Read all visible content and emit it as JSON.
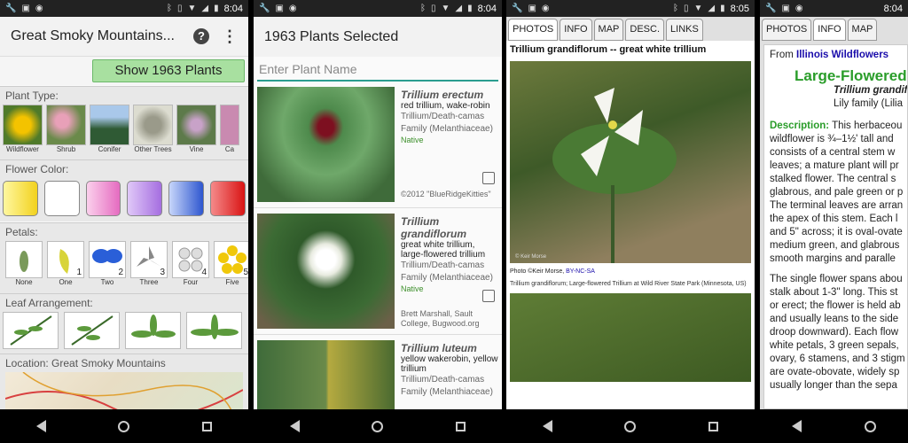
{
  "status": {
    "time1": "8:04",
    "time2": "8:04",
    "time3": "8:05",
    "time4": "8:04"
  },
  "p1": {
    "title": "Great Smoky Mountains...",
    "show_button": "Show 1963 Plants",
    "plant_type_label": "Plant Type:",
    "plant_types": [
      "Wildflower",
      "Shrub",
      "Conifer",
      "Other Trees",
      "Vine",
      "Ca"
    ],
    "flower_color_label": "Flower Color:",
    "colors": [
      "#f7e04a",
      "#ffffff",
      "#f28fd0",
      "#b77fe0",
      "#3a63d6",
      "#e02020"
    ],
    "petals_label": "Petals:",
    "petals": [
      {
        "label": "None",
        "n": ""
      },
      {
        "label": "One",
        "n": "1"
      },
      {
        "label": "Two",
        "n": "2"
      },
      {
        "label": "Three",
        "n": "3"
      },
      {
        "label": "Four",
        "n": "4"
      },
      {
        "label": "Five",
        "n": "5"
      }
    ],
    "leaf_label": "Leaf Arrangement:",
    "location_label": "Location: Great Smoky Mountains"
  },
  "p2": {
    "title": "1963 Plants Selected",
    "search_placeholder": "Enter Plant Name",
    "plants": [
      {
        "sci": "Trillium erectum",
        "common": "red trillium, wake-robin",
        "family": "Trillium/Death-camas Family (Melanthiaceae)",
        "native": "Native",
        "credit": "©2012 \"BlueRidgeKitties\""
      },
      {
        "sci": "Trillium grandiflorum",
        "common": "great white trillium, large-flowered trillium",
        "family": "Trillium/Death-camas Family (Melanthiaceae)",
        "native": "Native",
        "credit": "Brett Marshall, Sault College, Bugwood.org"
      },
      {
        "sci": "Trillium luteum",
        "common": "yellow wakerobin, yellow trillium",
        "family": "Trillium/Death-camas Family (Melanthiaceae)",
        "native": "",
        "credit": ""
      }
    ]
  },
  "p3": {
    "tabs": [
      "PHOTOS",
      "INFO",
      "MAP",
      "DESC.",
      "LINKS"
    ],
    "title": "Trillium grandiflorum -- great white trillium",
    "watermark": "© Keir Morse",
    "credit_prefix": "Photo ©Keir Morse, ",
    "credit_link": "BY-NC-SA",
    "caption": "Trillium grandiflorum; Large-flowered Trillium at Wild River State Park (Minnesota, US)"
  },
  "p4": {
    "tabs": [
      "PHOTOS",
      "INFO",
      "MAP"
    ],
    "from_prefix": "From ",
    "from_link": "Illinois Wildflowers",
    "heading": "Large-Flowered",
    "sci": "Trillium grandif",
    "family": "Lily family (Lilia",
    "desc_label": "Description:",
    "lines": [
      "wildflower is ¾–1½' tall and",
      "consists of a central stem w",
      "leaves; a mature plant will pr",
      "stalked flower. The central s",
      "glabrous, and pale green or p",
      "The terminal leaves are arran",
      "the apex of this stem. Each l",
      "and 5\" across; it is oval-ovate",
      "medium green, and glabrous",
      "smooth margins and paralle"
    ],
    "lines2": [
      "The single flower spans abou",
      "stalk about 1-3\" long. This st",
      "or erect; the flower is held ab",
      "and usually leans to the side",
      "droop downward). Each flow",
      "white petals, 3 green sepals,",
      "ovary, 6 stamens, and 3 stigm",
      "are ovate-obovate, widely sp",
      "usually longer than the sepa"
    ],
    "first_line": " This herbaceou"
  }
}
